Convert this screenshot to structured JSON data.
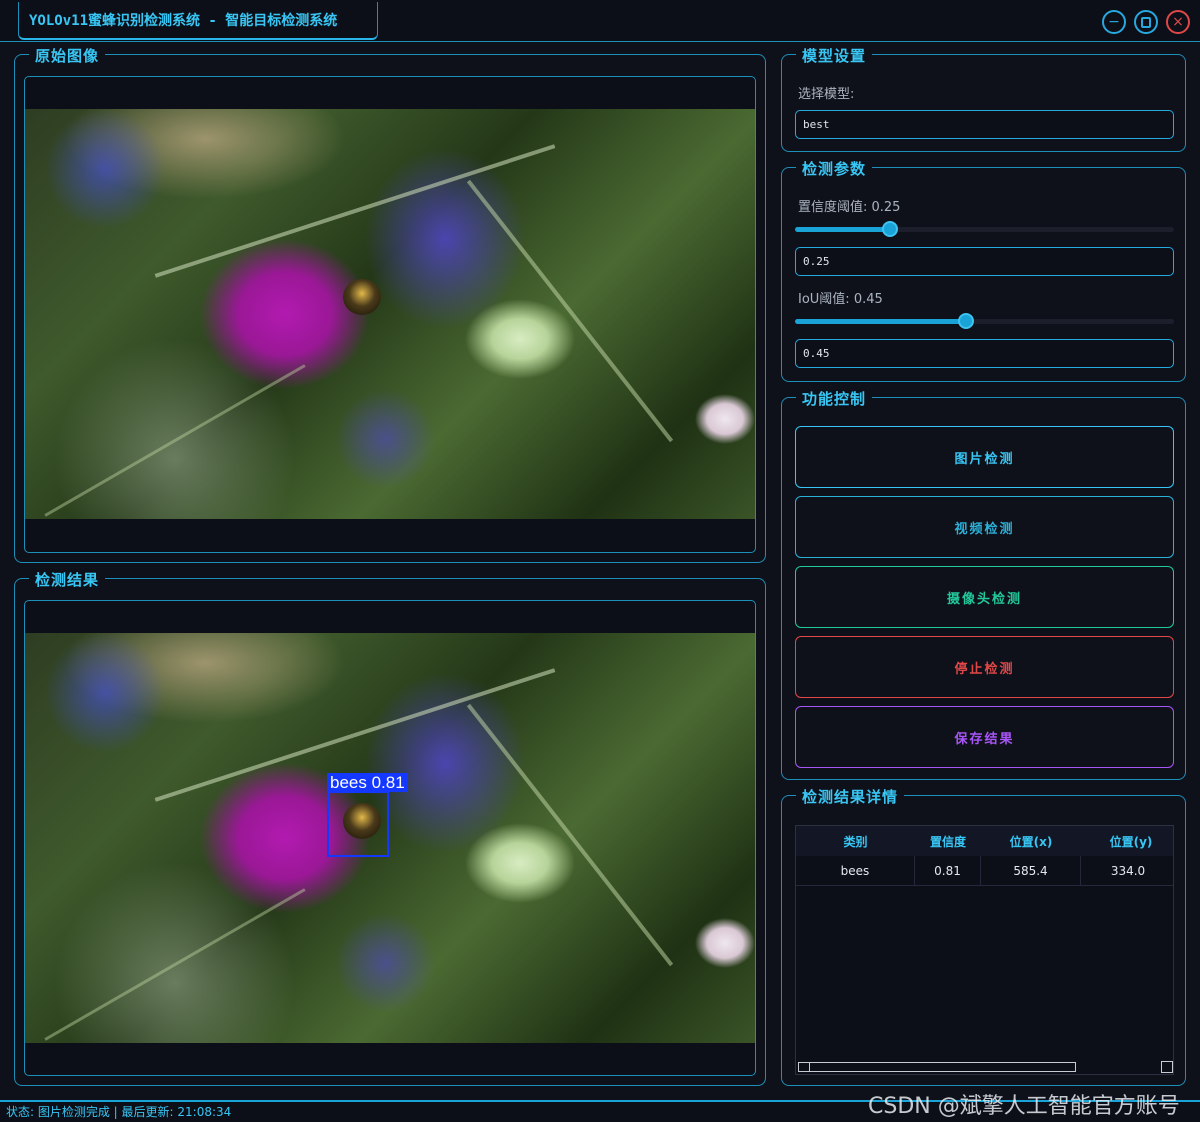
{
  "window": {
    "title": "YOLOv11蜜蜂识别检测系统 - 智能目标检测系统",
    "minimize_icon": "minimize-icon",
    "maximize_icon": "maximize-icon",
    "close_icon": "close-icon"
  },
  "original": {
    "title": "原始图像"
  },
  "result": {
    "title": "检测结果",
    "detection_label": "bees  0.81",
    "box_color": "#1438ff"
  },
  "model": {
    "title": "模型设置",
    "select_label": "选择模型:",
    "selected": "best"
  },
  "params": {
    "title": "检测参数",
    "conf_label": "置信度阈值: 0.25",
    "conf_value": "0.25",
    "conf_fraction": 0.25,
    "iou_label": "IoU阈值: 0.45",
    "iou_value": "0.45",
    "iou_fraction": 0.45
  },
  "controls": {
    "title": "功能控制",
    "image_detect": "图片检测",
    "video_detect": "视频检测",
    "camera_detect": "摄像头检测",
    "stop_detect": "停止检测",
    "save_result": "保存结果",
    "colors": {
      "image": "#38c6f4",
      "video": "#2bb0d8",
      "camera": "#22c99a",
      "stop": "#e04848",
      "save": "#a855f7"
    }
  },
  "details": {
    "title": "检测结果详情",
    "columns": [
      "类别",
      "置信度",
      "位置(x)",
      "位置(y)"
    ],
    "rows": [
      [
        "bees",
        "0.81",
        "585.4",
        "334.0"
      ]
    ]
  },
  "status": {
    "text": "状态: 图片检测完成 | 最后更新: 21:08:34"
  },
  "watermark": "CSDN @斌擎人工智能官方账号"
}
